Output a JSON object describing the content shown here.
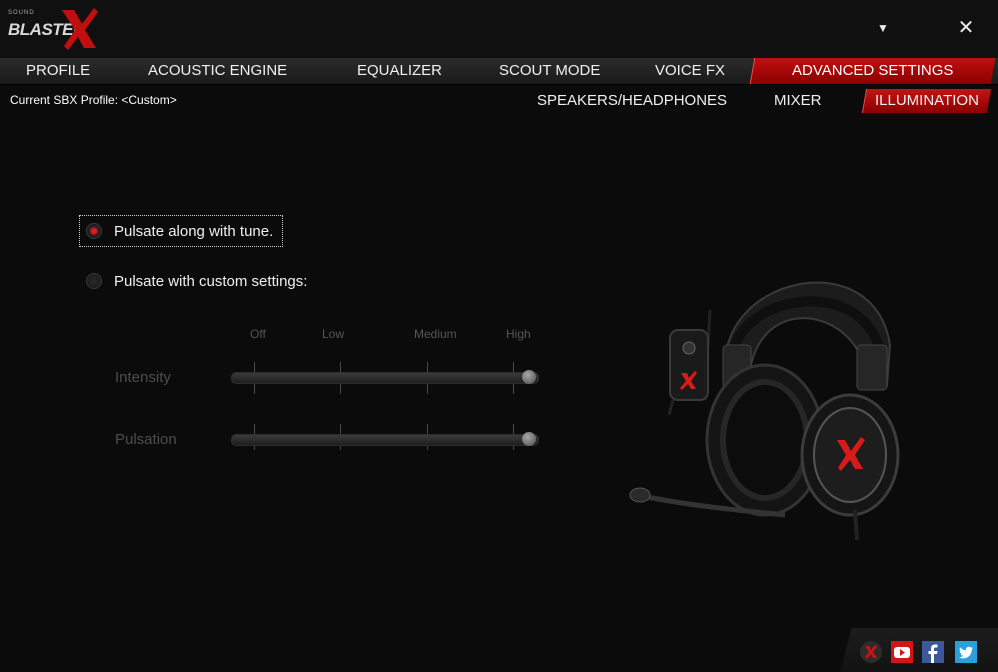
{
  "app": {
    "logo_small": "SOUND",
    "logo_text": "BLASTER",
    "accent_color": "#b30c0c"
  },
  "window_controls": {
    "menu_glyph": "▼",
    "close_glyph": "✕"
  },
  "main_tabs": [
    {
      "label": "PROFILE",
      "active": false
    },
    {
      "label": "ACOUSTIC ENGINE",
      "active": false
    },
    {
      "label": "EQUALIZER",
      "active": false
    },
    {
      "label": "SCOUT MODE",
      "active": false
    },
    {
      "label": "VOICE FX",
      "active": false
    },
    {
      "label": "ADVANCED SETTINGS",
      "active": true
    }
  ],
  "profile": {
    "label": "Current SBX Profile: <Custom>"
  },
  "sub_tabs": [
    {
      "label": "SPEAKERS/HEADPHONES",
      "active": false
    },
    {
      "label": "MIXER",
      "active": false
    },
    {
      "label": "ILLUMINATION",
      "active": true
    }
  ],
  "illumination": {
    "options": [
      {
        "label": "Pulsate along with tune.",
        "selected": true
      },
      {
        "label": "Pulsate with custom settings:",
        "selected": false
      }
    ],
    "scale_labels": [
      "Off",
      "Low",
      "Medium",
      "High"
    ],
    "sliders": [
      {
        "label": "Intensity",
        "level": "High",
        "enabled": false
      },
      {
        "label": "Pulsation",
        "level": "High",
        "enabled": false
      }
    ]
  },
  "social_icons": [
    "sound-blaster-x-icon",
    "youtube-icon",
    "facebook-icon",
    "twitter-icon"
  ]
}
